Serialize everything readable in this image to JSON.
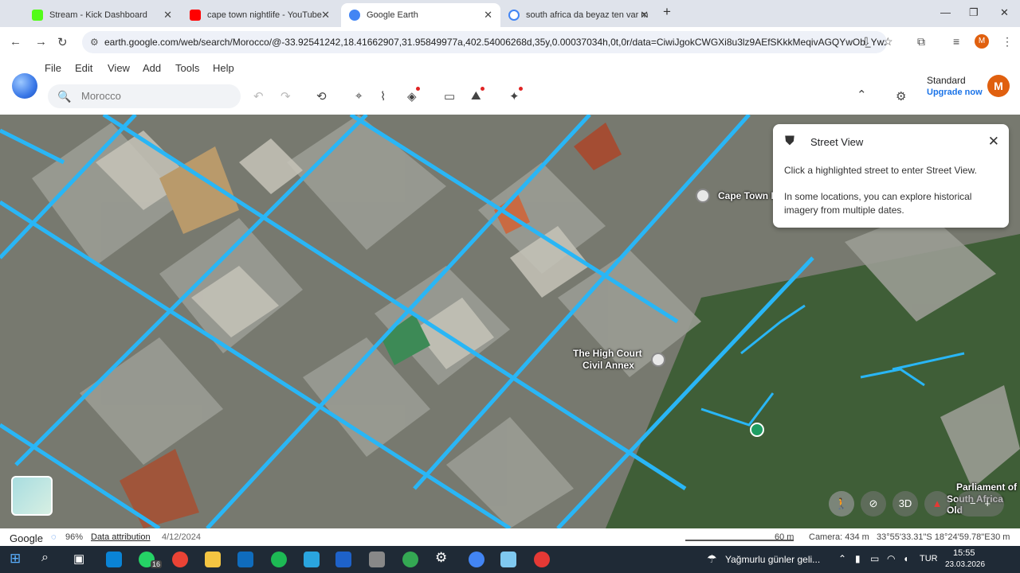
{
  "browser": {
    "tabs": [
      {
        "title": "Stream - Kick Dashboard",
        "color": "#53fc18"
      },
      {
        "title": "cape town nightlife - YouTube",
        "color": "#ff0000"
      },
      {
        "title": "Google Earth",
        "color": "#4285f4"
      },
      {
        "title": "south africa da beyaz ten var m",
        "color": "#4285f4"
      }
    ],
    "url": "earth.google.com/web/search/Morocco/@-33.92541242,18.41662907,31.95849977a,402.54006268d,35y,0.00037034h,0t,0r/data=CiwiJgokCWGXi8u3lz9AEfSKkkMeqivAGQYwOb_Yw..."
  },
  "app": {
    "menus": [
      "File",
      "Edit",
      "View",
      "Add",
      "Tools",
      "Help"
    ],
    "search_value": "Morocco",
    "plan": "Standard",
    "upgrade": "Upgrade now",
    "avatar_letter": "M"
  },
  "map": {
    "labels": {
      "poi1": "Cape Town I",
      "poi2_line1": "The High Court",
      "poi2_line2": "Civil Annex",
      "poi3_line1": "Parliament of",
      "poi3_line2": "South Africa Old"
    },
    "btn_3d": "3D"
  },
  "street_view": {
    "title": "Street View",
    "text1": "Click a highlighted street to enter Street View.",
    "text2": "In some locations, you can explore historical imagery from multiple dates."
  },
  "status": {
    "google": "Google",
    "loaded": "96%",
    "attribution": "Data attribution",
    "date": "4/12/2024",
    "scale": "60 m",
    "camera": "Camera: 434 m",
    "coords": "33°55'33.31\"S 18°24'59.78\"E",
    "alt": "30 m"
  },
  "taskbar": {
    "badge": "16",
    "weather": "Yağmurlu günler geli...",
    "lang": "TUR",
    "time": "15:55",
    "date": "23.03.2026"
  }
}
